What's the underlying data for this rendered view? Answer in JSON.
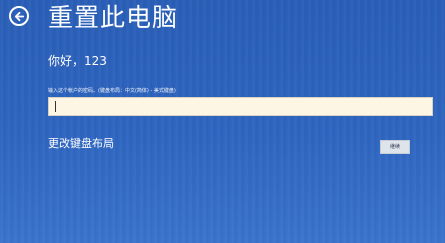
{
  "header": {
    "title": "重置此电脑",
    "back_icon": "back-arrow-icon"
  },
  "greeting": "你好，123",
  "password": {
    "label": "输入这个帐户的密码。(键盘布局：中文(简体) - 美式键盘)",
    "value": ""
  },
  "change_layout": {
    "label": "更改键盘布局"
  },
  "next_button": {
    "label": "继续"
  },
  "colors": {
    "background": "#2f66c1",
    "input_background": "#fdf6e4",
    "button_background": "#dfe3ea"
  }
}
